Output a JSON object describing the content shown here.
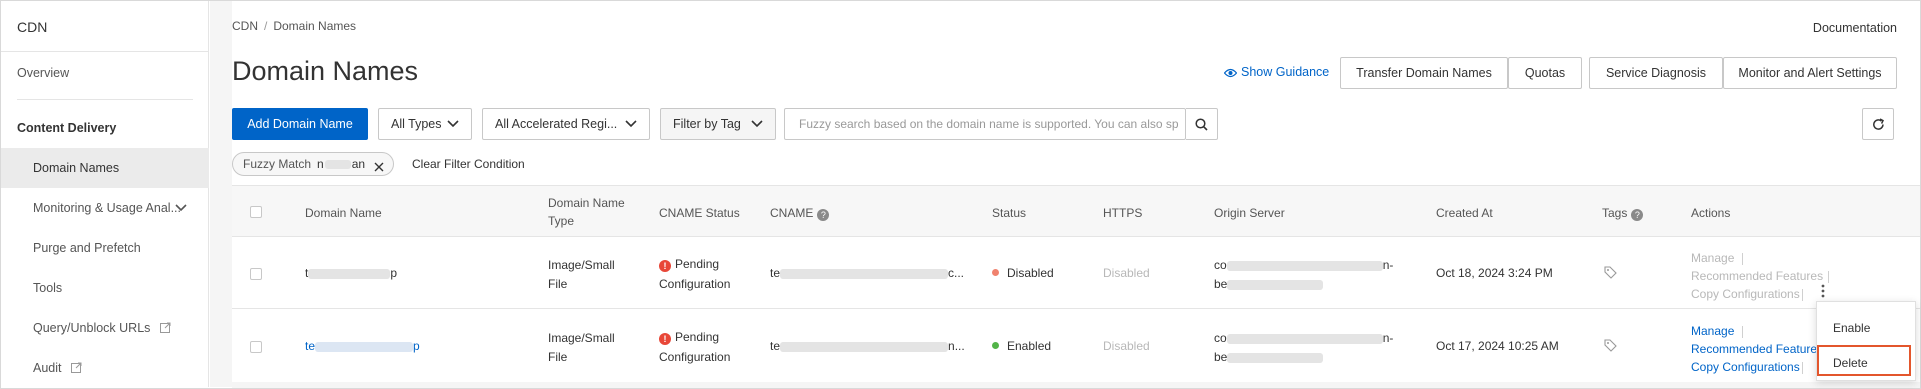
{
  "sidebar": {
    "title": "CDN",
    "overview": "Overview",
    "section": "Content Delivery",
    "items": [
      {
        "label": "Domain Names"
      },
      {
        "label": "Monitoring & Usage Anal..."
      },
      {
        "label": "Purge and Prefetch"
      },
      {
        "label": "Tools"
      },
      {
        "label": "Query/Unblock URLs"
      },
      {
        "label": "Audit"
      }
    ]
  },
  "breadcrumb": {
    "root": "CDN",
    "sep": "/",
    "current": "Domain Names"
  },
  "header": {
    "documentation": "Documentation",
    "title": "Domain Names",
    "show_guidance": "Show Guidance",
    "buttons": [
      "Transfer Domain Names",
      "Quotas",
      "Service Diagnosis",
      "Monitor and Alert Settings"
    ]
  },
  "toolbar": {
    "add_domain": "Add Domain Name",
    "types": "All Types",
    "regions": "All Accelerated Regi...",
    "filter_tag": "Filter by Tag",
    "search_placeholder": "Fuzzy search based on the domain name is supported. You can also sp"
  },
  "filter": {
    "chip_label": "Fuzzy Match",
    "chip_value_prefix": "n",
    "chip_value_suffix": "an",
    "clear": "Clear Filter Condition"
  },
  "table": {
    "columns": {
      "domain": "Domain Name",
      "type_line1": "Domain Name",
      "type_line2": "Type",
      "cname_status": "CNAME Status",
      "cname": "CNAME",
      "status": "Status",
      "https": "HTTPS",
      "origin": "Origin Server",
      "created": "Created At",
      "tags": "Tags",
      "actions": "Actions"
    },
    "rows": [
      {
        "domain_prefix": "t",
        "domain_suffix": "p",
        "type_line1": "Image/Small",
        "type_line2": "File",
        "cname_status_line1": "Pending",
        "cname_status_line2": "Configuration",
        "cname_prefix": "te",
        "cname_suffix": "c...",
        "status": "Disabled",
        "status_color": "#f0826e",
        "https": "Disabled",
        "origin_line1_prefix": "co",
        "origin_line1_suffix": "n-",
        "origin_line2_prefix": "be",
        "created": "Oct 18, 2024 3:24 PM",
        "actions": {
          "manage": "Manage",
          "recommended": "Recommended Features",
          "copy": "Copy Configurations"
        }
      },
      {
        "domain_prefix": "te",
        "domain_suffix": "p",
        "type_line1": "Image/Small",
        "type_line2": "File",
        "cname_status_line1": "Pending",
        "cname_status_line2": "Configuration",
        "cname_prefix": "te",
        "cname_suffix": "n...",
        "status": "Enabled",
        "status_color": "#52b448",
        "https": "Disabled",
        "origin_line1_prefix": "co",
        "origin_line1_suffix": "n-",
        "origin_line2_prefix": "be",
        "created": "Oct 17, 2024 10:25 AM",
        "actions": {
          "manage": "Manage",
          "recommended": "Recommended Features",
          "copy": "Copy Configurations"
        }
      }
    ]
  },
  "more_menu": {
    "enable": "Enable",
    "delete": "Delete"
  },
  "icons": {
    "ext": "external-link-icon",
    "refresh": "refresh-icon",
    "search": "search-icon",
    "tag": "tag-icon",
    "more": "more-vertical-icon"
  },
  "colors": {
    "primary": "#0064c8",
    "highlight": "#e3562c",
    "warning": "#e84738"
  }
}
